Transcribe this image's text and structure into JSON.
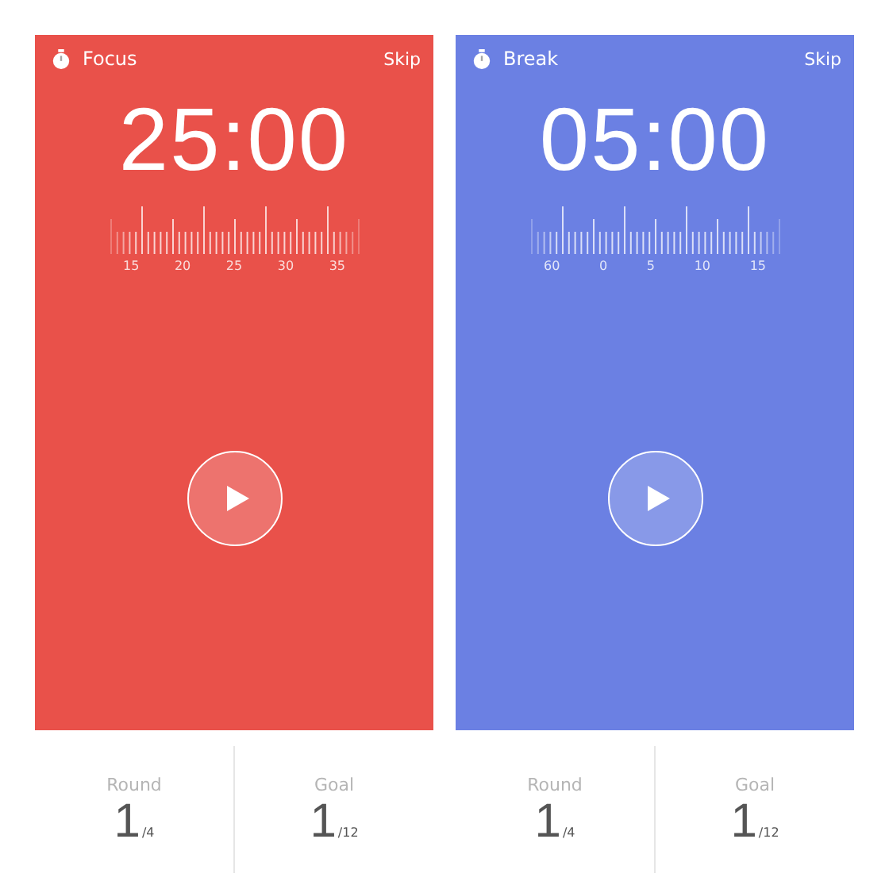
{
  "panels": [
    {
      "title": "Focus",
      "skip": "Skip",
      "time": "25:00",
      "color": "#e9514a",
      "ruler_labels": [
        "15",
        "20",
        "25",
        "30",
        "35"
      ],
      "stats": [
        {
          "label": "Round",
          "value": "1",
          "total": "/4"
        },
        {
          "label": "Goal",
          "value": "1",
          "total": "/12"
        }
      ]
    },
    {
      "title": "Break",
      "skip": "Skip",
      "time": "05:00",
      "color": "#6b80e3",
      "ruler_labels": [
        "60",
        "0",
        "5",
        "10",
        "15"
      ],
      "stats": [
        {
          "label": "Round",
          "value": "1",
          "total": "/4"
        },
        {
          "label": "Goal",
          "value": "1",
          "total": "/12"
        }
      ]
    }
  ]
}
